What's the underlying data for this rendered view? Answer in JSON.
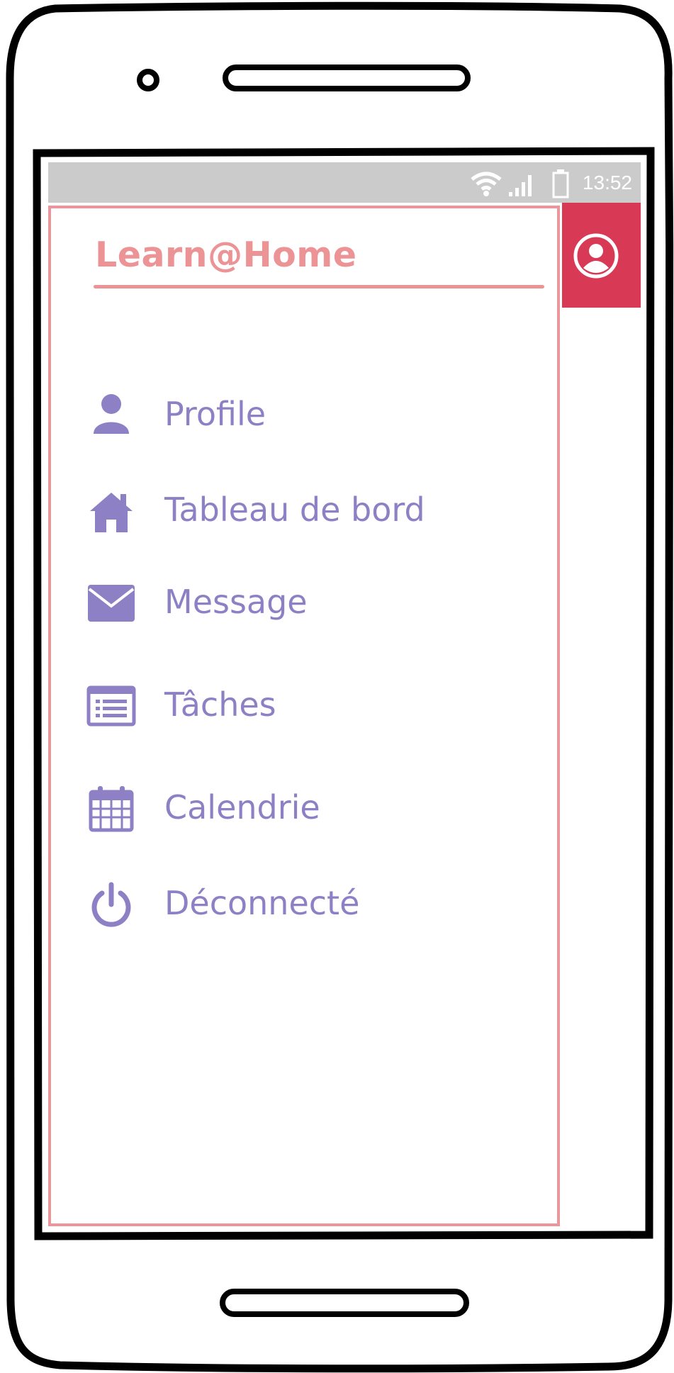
{
  "status_bar": {
    "time": "13:52",
    "icons": [
      "wifi-icon",
      "signal-icon",
      "battery-icon"
    ]
  },
  "app_bar": {
    "icons": [
      "account-circle-icon"
    ]
  },
  "drawer": {
    "title": "Learn@Home",
    "items": [
      {
        "label": "Profile",
        "icon": "person-icon"
      },
      {
        "label": "Tableau de bord",
        "icon": "home-icon"
      },
      {
        "label": "Message",
        "icon": "envelope-icon"
      },
      {
        "label": "Tâches",
        "icon": "task-list-icon"
      },
      {
        "label": "Calendrie",
        "icon": "calendar-icon"
      },
      {
        "label": "Déconnecté",
        "icon": "power-icon"
      }
    ]
  },
  "colors": {
    "accent": "#d83a55",
    "brand": "#ec9396",
    "menu_text": "#8d80c4",
    "status_bar": "#cbcbcb"
  }
}
